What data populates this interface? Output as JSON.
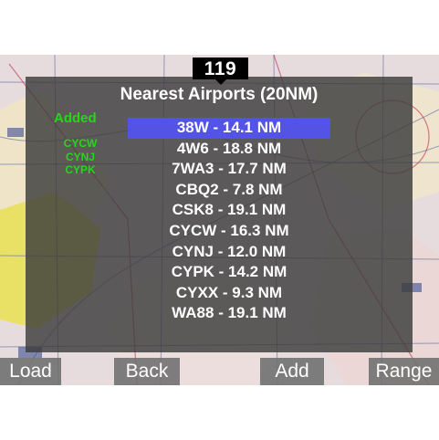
{
  "heading": {
    "value": "119"
  },
  "dialog": {
    "title": "Nearest Airports (20NM)",
    "added_label": "Added",
    "added": [
      "CYCW",
      "CYNJ",
      "CYPK"
    ],
    "airports": [
      {
        "label": "38W - 14.1 NM",
        "selected": true
      },
      {
        "label": "4W6 - 18.8 NM",
        "selected": false
      },
      {
        "label": "7WA3 - 17.7 NM",
        "selected": false
      },
      {
        "label": "CBQ2 - 7.8 NM",
        "selected": false
      },
      {
        "label": "CSK8 - 19.1 NM",
        "selected": false
      },
      {
        "label": "CYCW - 16.3 NM",
        "selected": false
      },
      {
        "label": "CYNJ - 12.0 NM",
        "selected": false
      },
      {
        "label": "CYPK - 14.2 NM",
        "selected": false
      },
      {
        "label": "CYXX - 9.3 NM",
        "selected": false
      },
      {
        "label": "WA88 - 19.1 NM",
        "selected": false
      }
    ]
  },
  "softkeys": {
    "load": "Load",
    "back": "Back",
    "add": "Add",
    "range": "Range"
  },
  "colors": {
    "added_text": "#27d51c",
    "selection": "#5353e6",
    "overlay": "#3c3c3c"
  }
}
